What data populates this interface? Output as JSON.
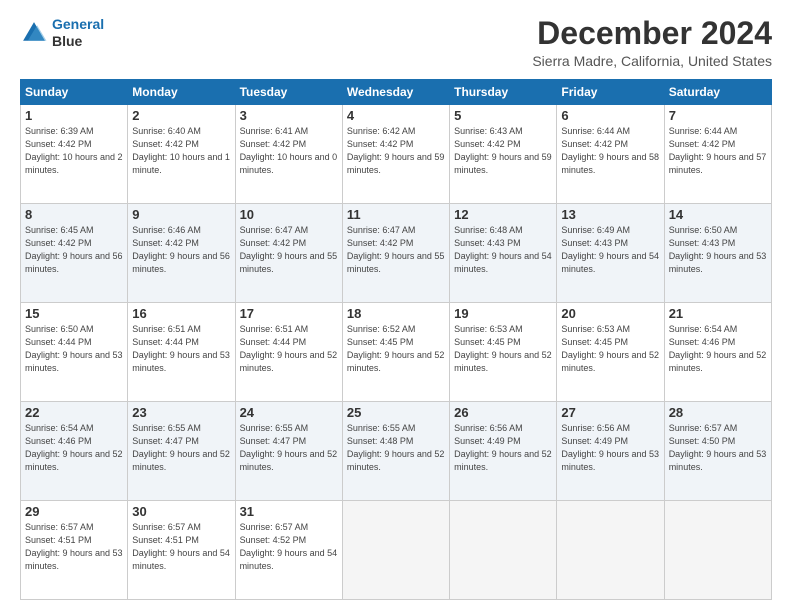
{
  "header": {
    "logo_line1": "General",
    "logo_line2": "Blue",
    "month": "December 2024",
    "location": "Sierra Madre, California, United States"
  },
  "weekdays": [
    "Sunday",
    "Monday",
    "Tuesday",
    "Wednesday",
    "Thursday",
    "Friday",
    "Saturday"
  ],
  "weeks": [
    [
      {
        "day": 1,
        "rise": "6:39 AM",
        "set": "4:42 PM",
        "daylight": "10 hours and 2 minutes."
      },
      {
        "day": 2,
        "rise": "6:40 AM",
        "set": "4:42 PM",
        "daylight": "10 hours and 1 minute."
      },
      {
        "day": 3,
        "rise": "6:41 AM",
        "set": "4:42 PM",
        "daylight": "10 hours and 0 minutes."
      },
      {
        "day": 4,
        "rise": "6:42 AM",
        "set": "4:42 PM",
        "daylight": "9 hours and 59 minutes."
      },
      {
        "day": 5,
        "rise": "6:43 AM",
        "set": "4:42 PM",
        "daylight": "9 hours and 59 minutes."
      },
      {
        "day": 6,
        "rise": "6:44 AM",
        "set": "4:42 PM",
        "daylight": "9 hours and 58 minutes."
      },
      {
        "day": 7,
        "rise": "6:44 AM",
        "set": "4:42 PM",
        "daylight": "9 hours and 57 minutes."
      }
    ],
    [
      {
        "day": 8,
        "rise": "6:45 AM",
        "set": "4:42 PM",
        "daylight": "9 hours and 56 minutes."
      },
      {
        "day": 9,
        "rise": "6:46 AM",
        "set": "4:42 PM",
        "daylight": "9 hours and 56 minutes."
      },
      {
        "day": 10,
        "rise": "6:47 AM",
        "set": "4:42 PM",
        "daylight": "9 hours and 55 minutes."
      },
      {
        "day": 11,
        "rise": "6:47 AM",
        "set": "4:42 PM",
        "daylight": "9 hours and 55 minutes."
      },
      {
        "day": 12,
        "rise": "6:48 AM",
        "set": "4:43 PM",
        "daylight": "9 hours and 54 minutes."
      },
      {
        "day": 13,
        "rise": "6:49 AM",
        "set": "4:43 PM",
        "daylight": "9 hours and 54 minutes."
      },
      {
        "day": 14,
        "rise": "6:50 AM",
        "set": "4:43 PM",
        "daylight": "9 hours and 53 minutes."
      }
    ],
    [
      {
        "day": 15,
        "rise": "6:50 AM",
        "set": "4:44 PM",
        "daylight": "9 hours and 53 minutes."
      },
      {
        "day": 16,
        "rise": "6:51 AM",
        "set": "4:44 PM",
        "daylight": "9 hours and 53 minutes."
      },
      {
        "day": 17,
        "rise": "6:51 AM",
        "set": "4:44 PM",
        "daylight": "9 hours and 52 minutes."
      },
      {
        "day": 18,
        "rise": "6:52 AM",
        "set": "4:45 PM",
        "daylight": "9 hours and 52 minutes."
      },
      {
        "day": 19,
        "rise": "6:53 AM",
        "set": "4:45 PM",
        "daylight": "9 hours and 52 minutes."
      },
      {
        "day": 20,
        "rise": "6:53 AM",
        "set": "4:45 PM",
        "daylight": "9 hours and 52 minutes."
      },
      {
        "day": 21,
        "rise": "6:54 AM",
        "set": "4:46 PM",
        "daylight": "9 hours and 52 minutes."
      }
    ],
    [
      {
        "day": 22,
        "rise": "6:54 AM",
        "set": "4:46 PM",
        "daylight": "9 hours and 52 minutes."
      },
      {
        "day": 23,
        "rise": "6:55 AM",
        "set": "4:47 PM",
        "daylight": "9 hours and 52 minutes."
      },
      {
        "day": 24,
        "rise": "6:55 AM",
        "set": "4:47 PM",
        "daylight": "9 hours and 52 minutes."
      },
      {
        "day": 25,
        "rise": "6:55 AM",
        "set": "4:48 PM",
        "daylight": "9 hours and 52 minutes."
      },
      {
        "day": 26,
        "rise": "6:56 AM",
        "set": "4:49 PM",
        "daylight": "9 hours and 52 minutes."
      },
      {
        "day": 27,
        "rise": "6:56 AM",
        "set": "4:49 PM",
        "daylight": "9 hours and 53 minutes."
      },
      {
        "day": 28,
        "rise": "6:57 AM",
        "set": "4:50 PM",
        "daylight": "9 hours and 53 minutes."
      }
    ],
    [
      {
        "day": 29,
        "rise": "6:57 AM",
        "set": "4:51 PM",
        "daylight": "9 hours and 53 minutes."
      },
      {
        "day": 30,
        "rise": "6:57 AM",
        "set": "4:51 PM",
        "daylight": "9 hours and 54 minutes."
      },
      {
        "day": 31,
        "rise": "6:57 AM",
        "set": "4:52 PM",
        "daylight": "9 hours and 54 minutes."
      },
      null,
      null,
      null,
      null
    ]
  ]
}
